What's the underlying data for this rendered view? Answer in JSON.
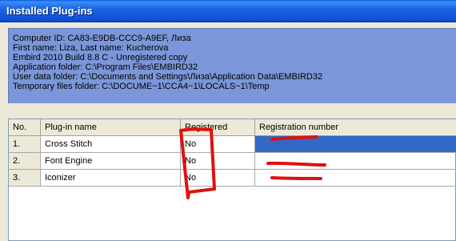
{
  "window": {
    "title": "Installed Plug-ins"
  },
  "info": {
    "lines": [
      "Computer ID: CA83-E9DB-CCC9-A9EF, Лиза",
      "First name: Liza, Last name: Kucherova",
      "Embird 2010 Build 8.8 C - Unregistered copy",
      "Application folder: C:\\Program Files\\EMBIRD32",
      "User data folder: C:\\Documents and Settings\\Лиза\\Application Data\\EMBIRD32",
      "Temporary files folder: C:\\DOCUME~1\\CCA4~1\\LOCALS~1\\Temp"
    ]
  },
  "table": {
    "headers": [
      "No.",
      "Plug-in name",
      "Registered",
      "Registration number"
    ],
    "rows": [
      {
        "no": "1.",
        "name": "Cross Stitch",
        "registered": "No",
        "regnum": ""
      },
      {
        "no": "2.",
        "name": "Font Engine",
        "registered": "No",
        "regnum": ""
      },
      {
        "no": "3.",
        "name": "Iconizer",
        "registered": "No",
        "regnum": ""
      }
    ],
    "selected_row": 1
  },
  "annotation_color": "#e01010"
}
